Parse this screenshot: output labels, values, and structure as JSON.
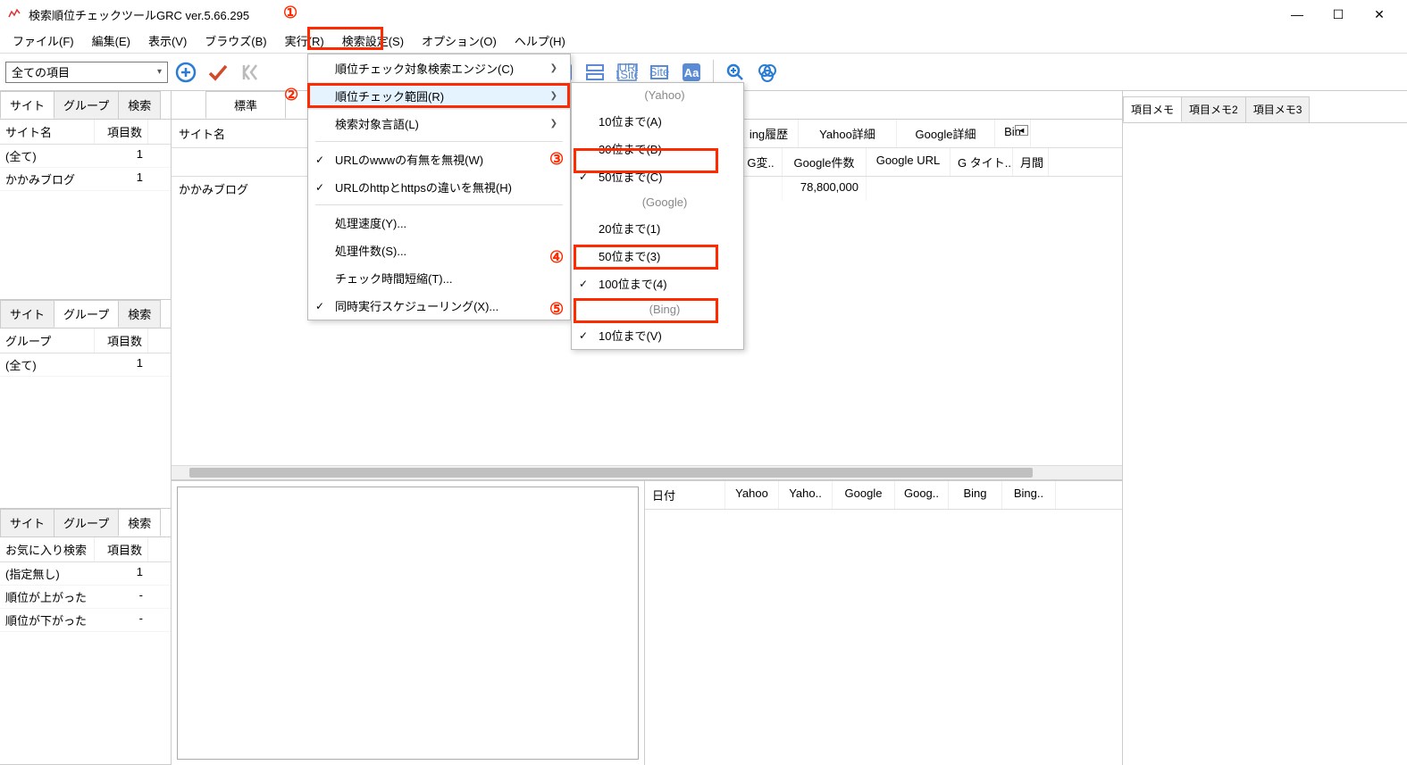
{
  "title": "検索順位チェックツールGRC  ver.5.66.295",
  "window_controls": {
    "min": "—",
    "max": "☐",
    "close": "✕"
  },
  "menubar": [
    "ファイル(F)",
    "編集(E)",
    "表示(V)",
    "ブラウズ(B)",
    "実行(R)",
    "検索設定(S)",
    "オプション(O)",
    "ヘルプ(H)"
  ],
  "filter_dropdown": "全ての項目",
  "left_tabs": {
    "site": "サイト",
    "group": "グループ",
    "search": "検索"
  },
  "left_panel_site": {
    "cols": {
      "name": "サイト名",
      "count": "項目数"
    },
    "rows": [
      {
        "name": "(全て)",
        "count": "1"
      },
      {
        "name": "かかみブログ",
        "count": "1"
      }
    ]
  },
  "left_panel_group": {
    "cols": {
      "name": "グループ",
      "count": "項目数"
    },
    "rows": [
      {
        "name": "(全て)",
        "count": "1"
      }
    ]
  },
  "left_panel_search": {
    "cols": {
      "name": "お気に入り検索",
      "count": "項目数"
    },
    "rows": [
      {
        "name": "(指定無し)",
        "count": "1"
      },
      {
        "name": "順位が上がった",
        "count": "-"
      },
      {
        "name": "順位が下がった",
        "count": "-"
      }
    ]
  },
  "center_tab_standard": "標準",
  "grid_headers": [
    "サイト名",
    "ing履歴",
    "Yahoo詳細",
    "Google詳細",
    "Bin",
    "G変..",
    "Google件数",
    "Google URL",
    "G タイト..",
    "月間"
  ],
  "grid_row": {
    "site": "かかみブログ",
    "google_count": "78,800,000"
  },
  "scroll_arrow": "◄",
  "dropdown1": {
    "items": [
      {
        "label": "順位チェック対象検索エンジン(C)",
        "arrow": true
      },
      {
        "label": "順位チェック範囲(R)",
        "arrow": true,
        "highlighted": true
      },
      {
        "label": "検索対象言語(L)",
        "arrow": true
      },
      {
        "sep": true
      },
      {
        "label": "URLのwwwの有無を無視(W)",
        "check": true
      },
      {
        "label": "URLのhttpとhttpsの違いを無視(H)",
        "check": true
      },
      {
        "sep": true
      },
      {
        "label": "処理速度(Y)..."
      },
      {
        "label": "処理件数(S)..."
      },
      {
        "label": "チェック時間短縮(T)..."
      },
      {
        "label": "同時実行スケジューリング(X)...",
        "check": true
      }
    ]
  },
  "dropdown2": {
    "sections": [
      {
        "header": "(Yahoo)",
        "items": [
          {
            "label": "10位まで(A)"
          },
          {
            "label": "30位まで(B)"
          },
          {
            "label": "50位まで(C)",
            "check": true
          }
        ]
      },
      {
        "header": "(Google)",
        "items": [
          {
            "label": "20位まで(1)"
          },
          {
            "label": "50位まで(3)"
          },
          {
            "label": "100位まで(4)",
            "check": true
          }
        ]
      },
      {
        "header": "(Bing)",
        "items": [
          {
            "label": "10位まで(V)",
            "check": true
          }
        ]
      }
    ]
  },
  "memo_tabs": [
    "項目メモ",
    "項目メモ2",
    "項目メモ3"
  ],
  "bottom_right_headers": [
    "日付",
    "Yahoo",
    "Yaho..",
    "Google",
    "Goog..",
    "Bing",
    "Bing.."
  ],
  "callouts": {
    "c1": "①",
    "c2": "②",
    "c3": "③",
    "c4": "④",
    "c5": "⑤"
  }
}
